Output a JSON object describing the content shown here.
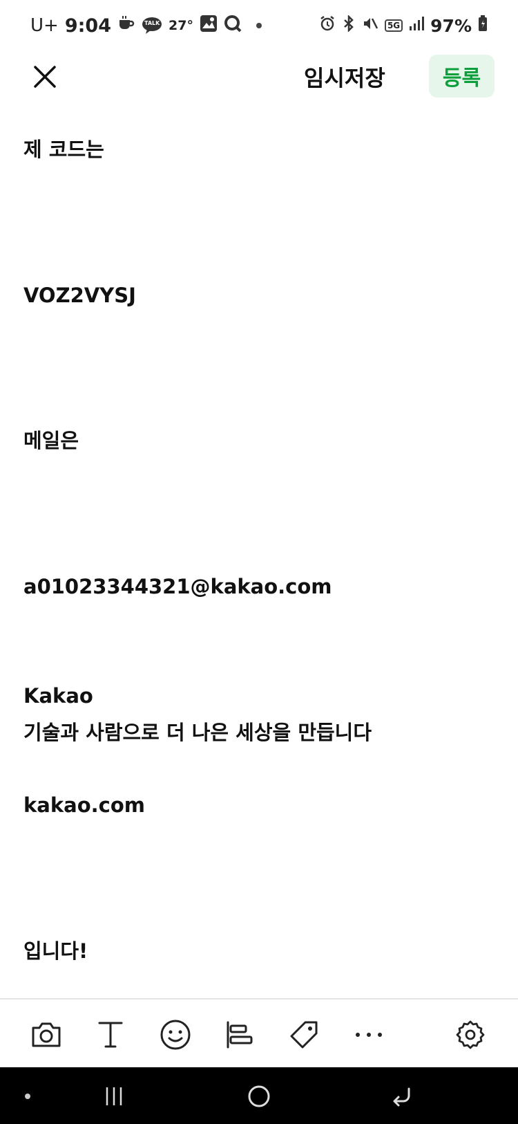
{
  "status_bar": {
    "carrier": "U+",
    "time": "9:04",
    "temperature": "27°",
    "talk_badge": "TALK",
    "network": "5G",
    "battery": "97%"
  },
  "header": {
    "draft_label": "임시저장",
    "submit_label": "등록"
  },
  "content": {
    "lines": [
      "제 코드는",
      "VOZ2VYSJ",
      "메일은",
      "a01023344321@kakao.com",
      "Kakao",
      "기술과 사람으로 더 나은 세상을 만듭니다",
      "kakao.com",
      "입니다!"
    ]
  },
  "toolbar": {
    "icons": [
      "camera-icon",
      "text-icon",
      "emoji-icon",
      "align-icon",
      "tag-icon",
      "more-icon",
      "settings-icon"
    ]
  },
  "colors": {
    "accent": "#0a9f3b",
    "accent_bg": "#e6f6ea",
    "navbar": "#000000"
  }
}
